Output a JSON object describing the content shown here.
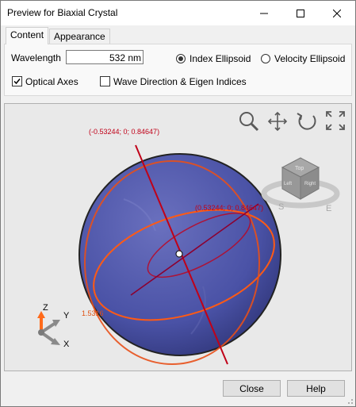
{
  "window": {
    "title": "Preview for Biaxial Crystal"
  },
  "tabs": [
    {
      "label": "Content"
    },
    {
      "label": "Appearance"
    }
  ],
  "content": {
    "wavelength_label": "Wavelength",
    "wavelength_value": "532 nm",
    "radio_index_label": "Index Ellipsoid",
    "radio_velocity_label": "Velocity Ellipsoid",
    "radio_selected": "Index Ellipsoid",
    "check_optical_axes_label": "Optical Axes",
    "check_optical_axes_checked": true,
    "check_wave_label": "Wave Direction & Eigen Indices",
    "check_wave_checked": false
  },
  "viewport": {
    "axis_label_top": "(-0.53244; 0; 0.84647)",
    "axis_label_right": "(0.53244; 0; 0.84647)",
    "index_label": "1.5316",
    "triad": {
      "z": "Z",
      "y": "Y",
      "x": "X"
    },
    "cube_labels": {
      "top": "Top",
      "left": "Left",
      "right": "Right"
    },
    "compass": {
      "south": "S",
      "east": "E"
    },
    "toolbar_icons": [
      "zoom-icon",
      "pan-icon",
      "rotate-icon",
      "fit-view-icon"
    ],
    "colors": {
      "sphere": "#4a52a6",
      "ellipse": "#ff5a14",
      "axis": "#c00018"
    }
  },
  "footer": {
    "close_label": "Close",
    "help_label": "Help"
  }
}
